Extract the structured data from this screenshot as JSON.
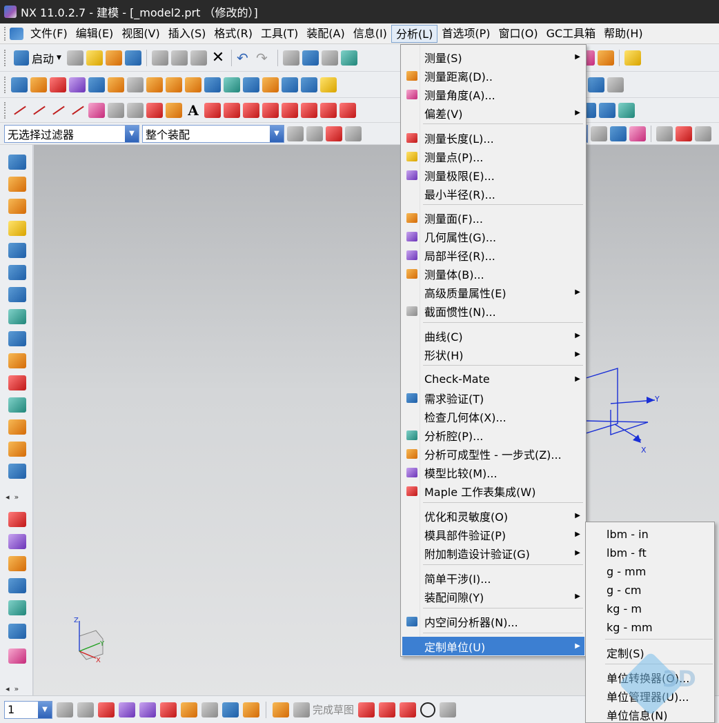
{
  "window": {
    "title": "NX 11.0.2.7 - 建模 - [_model2.prt （修改的）]"
  },
  "menubar": {
    "items": [
      "文件(F)",
      "编辑(E)",
      "视图(V)",
      "插入(S)",
      "格式(R)",
      "工具(T)",
      "装配(A)",
      "信息(I)",
      "分析(L)",
      "首选项(P)",
      "窗口(O)",
      "GC工具箱",
      "帮助(H)"
    ],
    "active": "分析(L)"
  },
  "toolbar": {
    "start_label": "启动",
    "filter_value": "无选择过滤器",
    "assembly_value": "整个装配"
  },
  "analysis_menu": {
    "items": [
      {
        "label": "测量(S)",
        "submenu": true
      },
      {
        "label": "测量距离(D)..",
        "icon": "measure-distance-icon"
      },
      {
        "label": "测量角度(A)...",
        "icon": "measure-angle-icon"
      },
      {
        "label": "偏差(V)",
        "submenu": true
      },
      {
        "label": "测量长度(L)...",
        "icon": "measure-length-icon"
      },
      {
        "label": "测量点(P)...",
        "icon": "measure-point-icon"
      },
      {
        "label": "测量极限(E)...",
        "icon": "measure-limits-icon"
      },
      {
        "label": "最小半径(R)..."
      },
      {
        "label": "测量面(F)...",
        "icon": "measure-face-icon"
      },
      {
        "label": "几何属性(G)...",
        "icon": "geometric-properties-icon"
      },
      {
        "label": "局部半径(R)...",
        "icon": "local-radius-icon"
      },
      {
        "label": "测量体(B)...",
        "icon": "measure-body-icon"
      },
      {
        "label": "高级质量属性(E)",
        "submenu": true
      },
      {
        "label": "截面惯性(N)...",
        "icon": "section-inertia-icon"
      },
      {
        "label": "曲线(C)",
        "submenu": true
      },
      {
        "label": "形状(H)",
        "submenu": true
      },
      {
        "label": "Check-Mate",
        "submenu": true
      },
      {
        "label": "需求验证(T)",
        "icon": "requirements-icon"
      },
      {
        "label": "检查几何体(X)..."
      },
      {
        "label": "分析腔(P)...",
        "icon": "cavity-icon"
      },
      {
        "label": "分析可成型性 - 一步式(Z)...",
        "icon": "formability-icon"
      },
      {
        "label": "模型比较(M)...",
        "icon": "model-compare-icon"
      },
      {
        "label": "Maple 工作表集成(W)",
        "icon": "maple-icon"
      },
      {
        "label": "优化和灵敏度(O)",
        "submenu": true
      },
      {
        "label": "模具部件验证(P)",
        "submenu": true
      },
      {
        "label": "附加制造设计验证(G)",
        "submenu": true
      },
      {
        "label": "简单干涉(I)..."
      },
      {
        "label": "装配间隙(Y)",
        "submenu": true
      },
      {
        "label": "内空间分析器(N)...",
        "icon": "interior-space-icon"
      },
      {
        "label": "定制单位(U)",
        "submenu": true,
        "highlighted": true
      }
    ]
  },
  "units_submenu": {
    "items": [
      "lbm - in",
      "lbm - ft",
      "g - mm",
      "g - cm",
      "kg - m",
      "kg - mm",
      "定制(S)",
      "单位转换器(O)...",
      "单位管理器(U)...",
      "单位信息(N)"
    ]
  },
  "csys": {
    "triad_axes": [
      "Y",
      "X"
    ],
    "small_triad_axes": [
      "Z",
      "Y",
      "X"
    ]
  },
  "bottom_toolbar": {
    "layer_value": "1",
    "finish_sketch_label": "完成草图"
  },
  "watermark_text": "3D"
}
